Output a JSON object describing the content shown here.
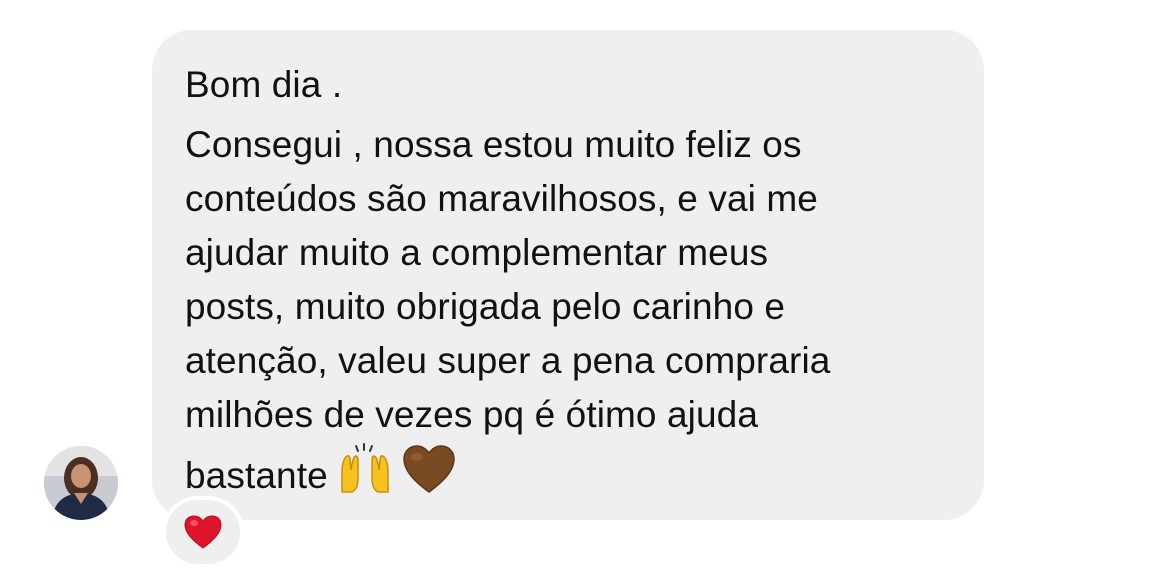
{
  "message": {
    "lines": [
      "Bom dia .",
      "Consegui , nossa estou muito feliz os",
      "conteúdos são maravilhosos, e vai me",
      "ajudar muito a complementar meus",
      "posts, muito obrigada pelo carinho e",
      "atenção, valeu super a pena compraria",
      "milhões de vezes pq é ótimo ajuda",
      "bastante"
    ],
    "emojis": [
      "raising-hands-icon",
      "brown-heart-icon"
    ]
  },
  "reaction": {
    "icon": "red-heart-icon"
  },
  "sender": {
    "avatar_icon": "avatar"
  },
  "colors": {
    "bubble": "#efeff0",
    "text": "#111111",
    "background": "#ffffff",
    "reaction_heart": "#e0142b",
    "brown_heart": "#7a4a22",
    "hands": "#f7c21e"
  }
}
